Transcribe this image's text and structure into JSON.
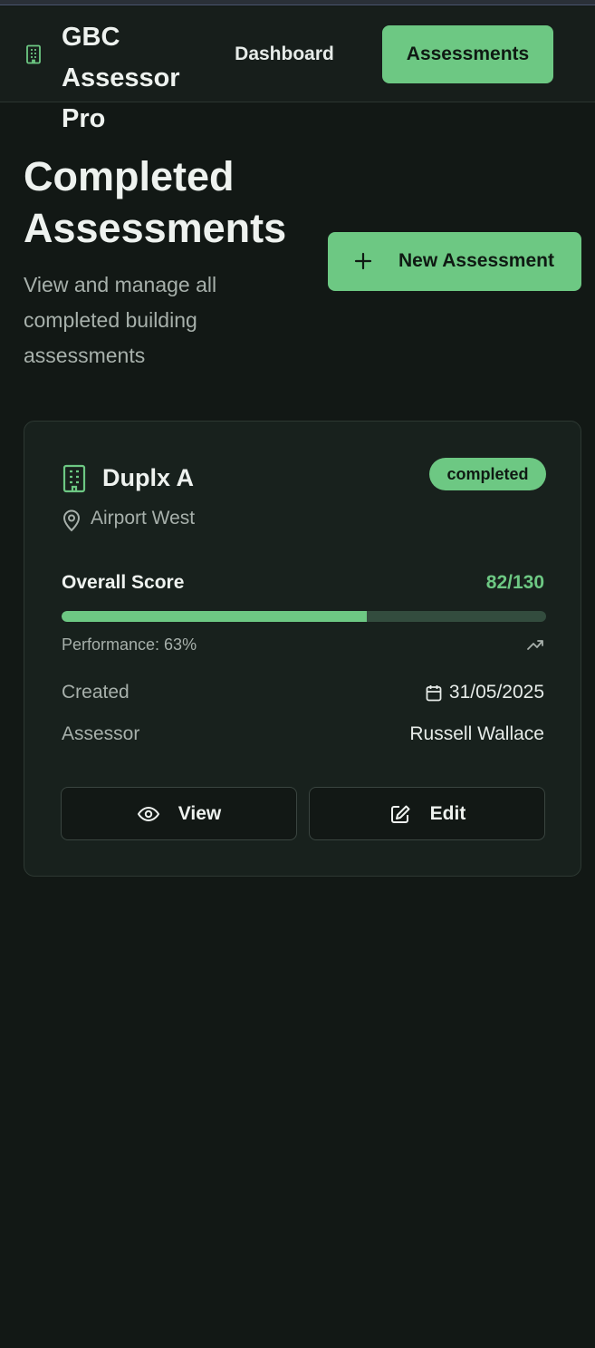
{
  "app": {
    "name": "GBC Assessor Pro"
  },
  "nav": {
    "dashboard": "Dashboard",
    "assessments": "Assessments"
  },
  "page": {
    "title": "Completed Assessments",
    "subtitle": "View and manage all completed building assessments",
    "new_button": "New Assessment"
  },
  "assessment": {
    "name": "Duplx A",
    "status": "completed",
    "location": "Airport West",
    "score_label": "Overall Score",
    "score": "82/130",
    "performance_label": "Performance: 63%",
    "performance_fraction": 0.63,
    "created_label": "Created",
    "created_date": "31/05/2025",
    "assessor_label": "Assessor",
    "assessor_name": "Russell Wallace",
    "view_label": "View",
    "edit_label": "Edit"
  },
  "icons": [
    "building-icon",
    "map-pin-icon",
    "trending-up-icon",
    "calendar-icon",
    "eye-icon",
    "edit-icon",
    "plus-icon"
  ],
  "colors": {
    "accent": "#6dc883",
    "background": "#121815",
    "card": "#18211d",
    "track": "#334c3e"
  }
}
